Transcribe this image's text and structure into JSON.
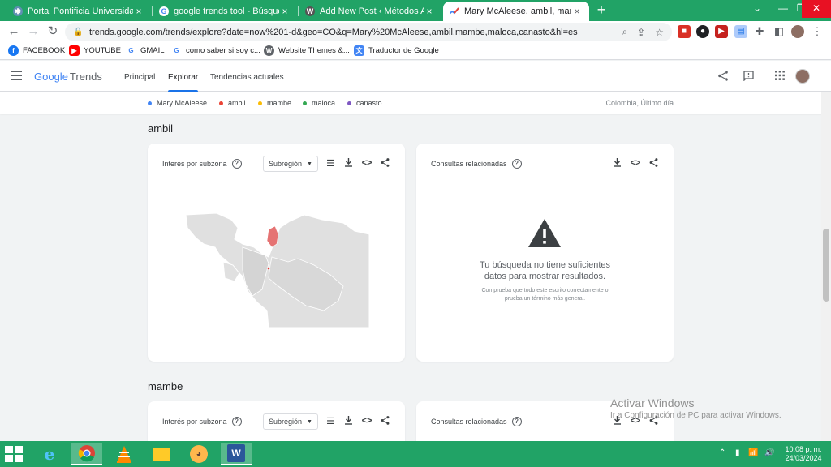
{
  "browser": {
    "tabs": [
      {
        "title": "Portal Pontificia Universidad Javeriana",
        "icon": "portal-icon"
      },
      {
        "title": "google trends tool - Búsqueda de Google",
        "icon": "google-g-icon"
      },
      {
        "title": "Add New Post ‹ Métodos Avanzados",
        "icon": "wordpress-icon"
      },
      {
        "title": "Mary McAleese, ambil, mambe, maloca, canasto",
        "icon": "trends-icon"
      }
    ],
    "url": "trends.google.com/trends/explore?date=now%201-d&geo=CO&q=Mary%20McAleese,ambil,mambe,maloca,canasto&hl=es",
    "bookmarks": [
      {
        "label": "FACEBOOK",
        "icon": "facebook-icon",
        "color": "#1877f2"
      },
      {
        "label": "YOUTUBE",
        "icon": "youtube-icon",
        "color": "#ff0000"
      },
      {
        "label": "GMAIL",
        "icon": "google-g-icon",
        "color": "#4285f4"
      },
      {
        "label": "como saber si soy c...",
        "icon": "google-g-icon",
        "color": "#4285f4"
      },
      {
        "label": "Website Themes &...",
        "icon": "wordpress-icon",
        "color": "#5f6368"
      },
      {
        "label": "Traductor de Google",
        "icon": "translate-icon",
        "color": "#4285f4"
      }
    ]
  },
  "trends": {
    "logo_google": "Google",
    "logo_trends": "Trends",
    "nav": [
      "Principal",
      "Explorar",
      "Tendencias actuales"
    ],
    "terms": [
      {
        "label": "Mary McAleese",
        "color": "#4285f4"
      },
      {
        "label": "ambil",
        "color": "#ea4335"
      },
      {
        "label": "mambe",
        "color": "#fbbc04"
      },
      {
        "label": "maloca",
        "color": "#34a853"
      },
      {
        "label": "canasto",
        "color": "#7e57c2"
      }
    ],
    "geo_time": "Colombia, Último día",
    "sections": [
      {
        "title": "ambil",
        "left_card": {
          "title": "Interés por subzona",
          "select": "Subregión"
        },
        "right_card": {
          "title": "Consultas relacionadas",
          "warning_title_line1": "Tu búsqueda no tiene suficientes",
          "warning_title_line2": "datos para mostrar resultados.",
          "warning_sub_line1": "Comprueba que todo este escrito correctamente o",
          "warning_sub_line2": "prueba un término más general."
        }
      },
      {
        "title": "mambe",
        "left_card": {
          "title": "Interés por subzona",
          "select": "Subregión"
        },
        "right_card": {
          "title": "Consultas relacionadas"
        }
      }
    ]
  },
  "watermark": {
    "line1": "Activar Windows",
    "line2": "Ir a Configuración de PC para activar Windows."
  },
  "taskbar": {
    "time": "10:08 p. m.",
    "date": "24/03/2024"
  }
}
